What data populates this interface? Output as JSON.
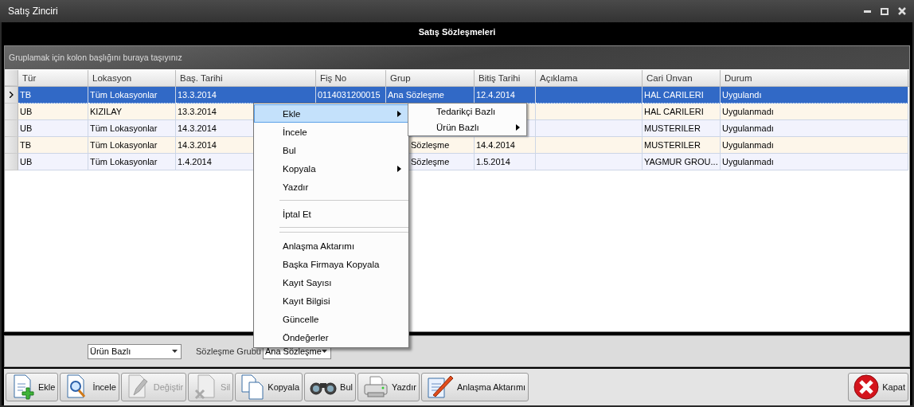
{
  "window": {
    "title": "Satış Zinciri"
  },
  "header": {
    "title": "Satış Sözleşmeleri"
  },
  "grid": {
    "group_hint": "Gruplamak için kolon başlığını buraya taşıyınız",
    "columns": [
      "Tür",
      "Lokasyon",
      "Baş. Tarihi",
      "Fiş No",
      "Grup",
      "Bitiş Tarihi",
      "Açıklama",
      "Cari Ünvan",
      "Durum"
    ],
    "rows": [
      {
        "selected": true,
        "cells": [
          {
            "text": "TB"
          },
          {
            "text": "Tüm Lokasyonlar"
          },
          {
            "text": "13.3.2014"
          },
          {
            "text": "0114031200015"
          },
          {
            "text": "Ana Sözleşme"
          },
          {
            "text": "12.4.2014"
          },
          {},
          {
            "text": "HAL CARILERI"
          },
          {
            "text": "Uygulandı"
          }
        ]
      },
      {
        "selected": false,
        "cells": [
          {
            "text": "UB"
          },
          {
            "text": "KIZILAY"
          },
          {
            "text": "13.3.2014"
          },
          null,
          null,
          {},
          {},
          {
            "text": "HAL CARILERI"
          },
          {
            "text": "Uygulanmadı"
          }
        ]
      },
      {
        "selected": false,
        "cells": [
          {
            "text": "UB"
          },
          {
            "text": "Tüm Lokasyonlar"
          },
          {
            "text": "14.3.2014"
          },
          null,
          null,
          {},
          {},
          {
            "text": "MUSTERILER"
          },
          {
            "text": "Uygulanmadı"
          }
        ]
      },
      {
        "selected": false,
        "cells": [
          {
            "text": "TB"
          },
          {
            "text": "Tüm Lokasyonlar"
          },
          {
            "text": "14.3.2014"
          },
          null,
          {
            "text": "Sözleşme",
            "clipped": true
          },
          {
            "text": "14.4.2014"
          },
          {},
          {
            "text": "MUSTERILER"
          },
          {
            "text": "Uygulanmadı"
          }
        ]
      },
      {
        "selected": false,
        "cells": [
          {
            "text": "UB"
          },
          {
            "text": "Tüm Lokasyonlar"
          },
          {
            "text": "1.4.2014"
          },
          null,
          {
            "text": "Sözleşme",
            "clipped": true
          },
          {
            "text": "1.5.2014"
          },
          {},
          {
            "text": "YAGMUR GROU..."
          },
          {
            "text": "Uygulanmadı"
          }
        ]
      }
    ]
  },
  "context_menu": {
    "items": [
      {
        "kind": "item",
        "label": "Ekle",
        "selected": true,
        "submenu": true
      },
      {
        "kind": "item",
        "label": "İncele",
        "selected": false,
        "submenu": false
      },
      {
        "kind": "item",
        "label": "Bul",
        "selected": false,
        "submenu": false
      },
      {
        "kind": "item",
        "label": "Kopyala",
        "selected": false,
        "submenu": true
      },
      {
        "kind": "item",
        "label": "Yazdır",
        "selected": false,
        "submenu": false
      },
      {
        "kind": "separator"
      },
      {
        "kind": "item",
        "label": "İptal Et",
        "selected": false,
        "submenu": false
      },
      {
        "kind": "separator"
      },
      {
        "kind": "separator"
      },
      {
        "kind": "item",
        "label": "Anlaşma Aktarımı",
        "selected": false,
        "submenu": false
      },
      {
        "kind": "item",
        "label": "Başka Firmaya Kopyala",
        "selected": false,
        "submenu": false
      },
      {
        "kind": "item",
        "label": "Kayıt Sayısı",
        "selected": false,
        "submenu": false
      },
      {
        "kind": "item",
        "label": "Kayıt Bilgisi",
        "selected": false,
        "submenu": false
      },
      {
        "kind": "item",
        "label": "Güncelle",
        "selected": false,
        "submenu": false
      },
      {
        "kind": "item",
        "label": "Öndeğerler",
        "selected": false,
        "submenu": false
      }
    ],
    "submenu": [
      {
        "label": "Tedarikçi Bazlı",
        "submenu": false
      },
      {
        "label": "Ürün Bazlı",
        "submenu": true
      }
    ]
  },
  "filters": {
    "type_value": "Ürün Bazlı",
    "group_label": "Sözleşme Grubu",
    "group_value": "Ana Sözleşme"
  },
  "toolbar": [
    {
      "label": "Ekle",
      "disabled": false
    },
    {
      "label": "İncele",
      "disabled": false
    },
    {
      "label": "Değiştir",
      "disabled": true
    },
    {
      "label": "Sil",
      "disabled": true
    },
    {
      "label": "Kopyala",
      "disabled": false
    },
    {
      "label": "Bul",
      "disabled": false
    },
    {
      "label": "Yazdır",
      "disabled": false
    },
    {
      "label": "Anlaşma Aktarımı",
      "disabled": false
    }
  ],
  "close_button": {
    "label": "Kapat",
    "disabled": false
  }
}
